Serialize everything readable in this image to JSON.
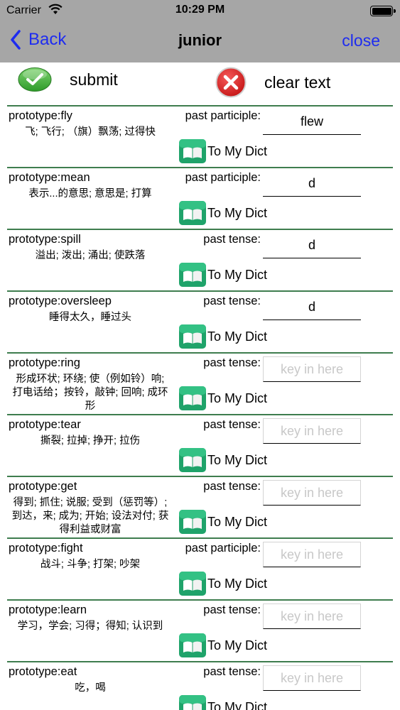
{
  "status": {
    "carrier": "Carrier",
    "time": "10:29 PM"
  },
  "nav": {
    "back_label": "Back",
    "title": "junior",
    "close_label": "close"
  },
  "actions": {
    "submit_label": "submit",
    "clear_label": "clear text"
  },
  "colors": {
    "accent": "#1e2cf0",
    "divider": "#3e7d4e",
    "nav_background": "#a6a6a6"
  },
  "dict_label": "To My Dict",
  "placeholder": "key in here",
  "words": [
    {
      "prototype": "prototype:fly",
      "meaning": "飞; 飞行; （旗）飘荡; 过得快",
      "tense": "past participle:",
      "value": "flew"
    },
    {
      "prototype": "prototype:mean",
      "meaning": "表示...的意思; 意思是; 打算",
      "tense": "past participle:",
      "value": "d"
    },
    {
      "prototype": "prototype:spill",
      "meaning": "溢出; 泼出; 涌出; 使跌落",
      "tense": "past tense:",
      "value": "d"
    },
    {
      "prototype": "prototype:oversleep",
      "meaning": "睡得太久，睡过头",
      "tense": "past tense:",
      "value": "d"
    },
    {
      "prototype": "prototype:ring",
      "meaning": "形成环状; 环绕; 使（例如铃）响; 打电话给；按铃，敲钟; 回响; 成环形",
      "tense": "past tense:",
      "value": ""
    },
    {
      "prototype": "prototype:tear",
      "meaning": "撕裂; 拉掉; 挣开; 拉伤",
      "tense": "past tense:",
      "value": ""
    },
    {
      "prototype": "prototype:get",
      "meaning": "得到; 抓住; 说服; 受到（惩罚等）; 到达，来; 成为; 开始; 设法对付; 获得利益或财富",
      "tense": "past tense:",
      "value": ""
    },
    {
      "prototype": "prototype:fight",
      "meaning": "战斗; 斗争; 打架; 吵架",
      "tense": "past participle:",
      "value": ""
    },
    {
      "prototype": "prototype:learn",
      "meaning": "学习，学会; 习得；得知; 认识到",
      "tense": "past tense:",
      "value": ""
    },
    {
      "prototype": "prototype:eat",
      "meaning": "吃，喝",
      "tense": "past tense:",
      "value": ""
    }
  ]
}
